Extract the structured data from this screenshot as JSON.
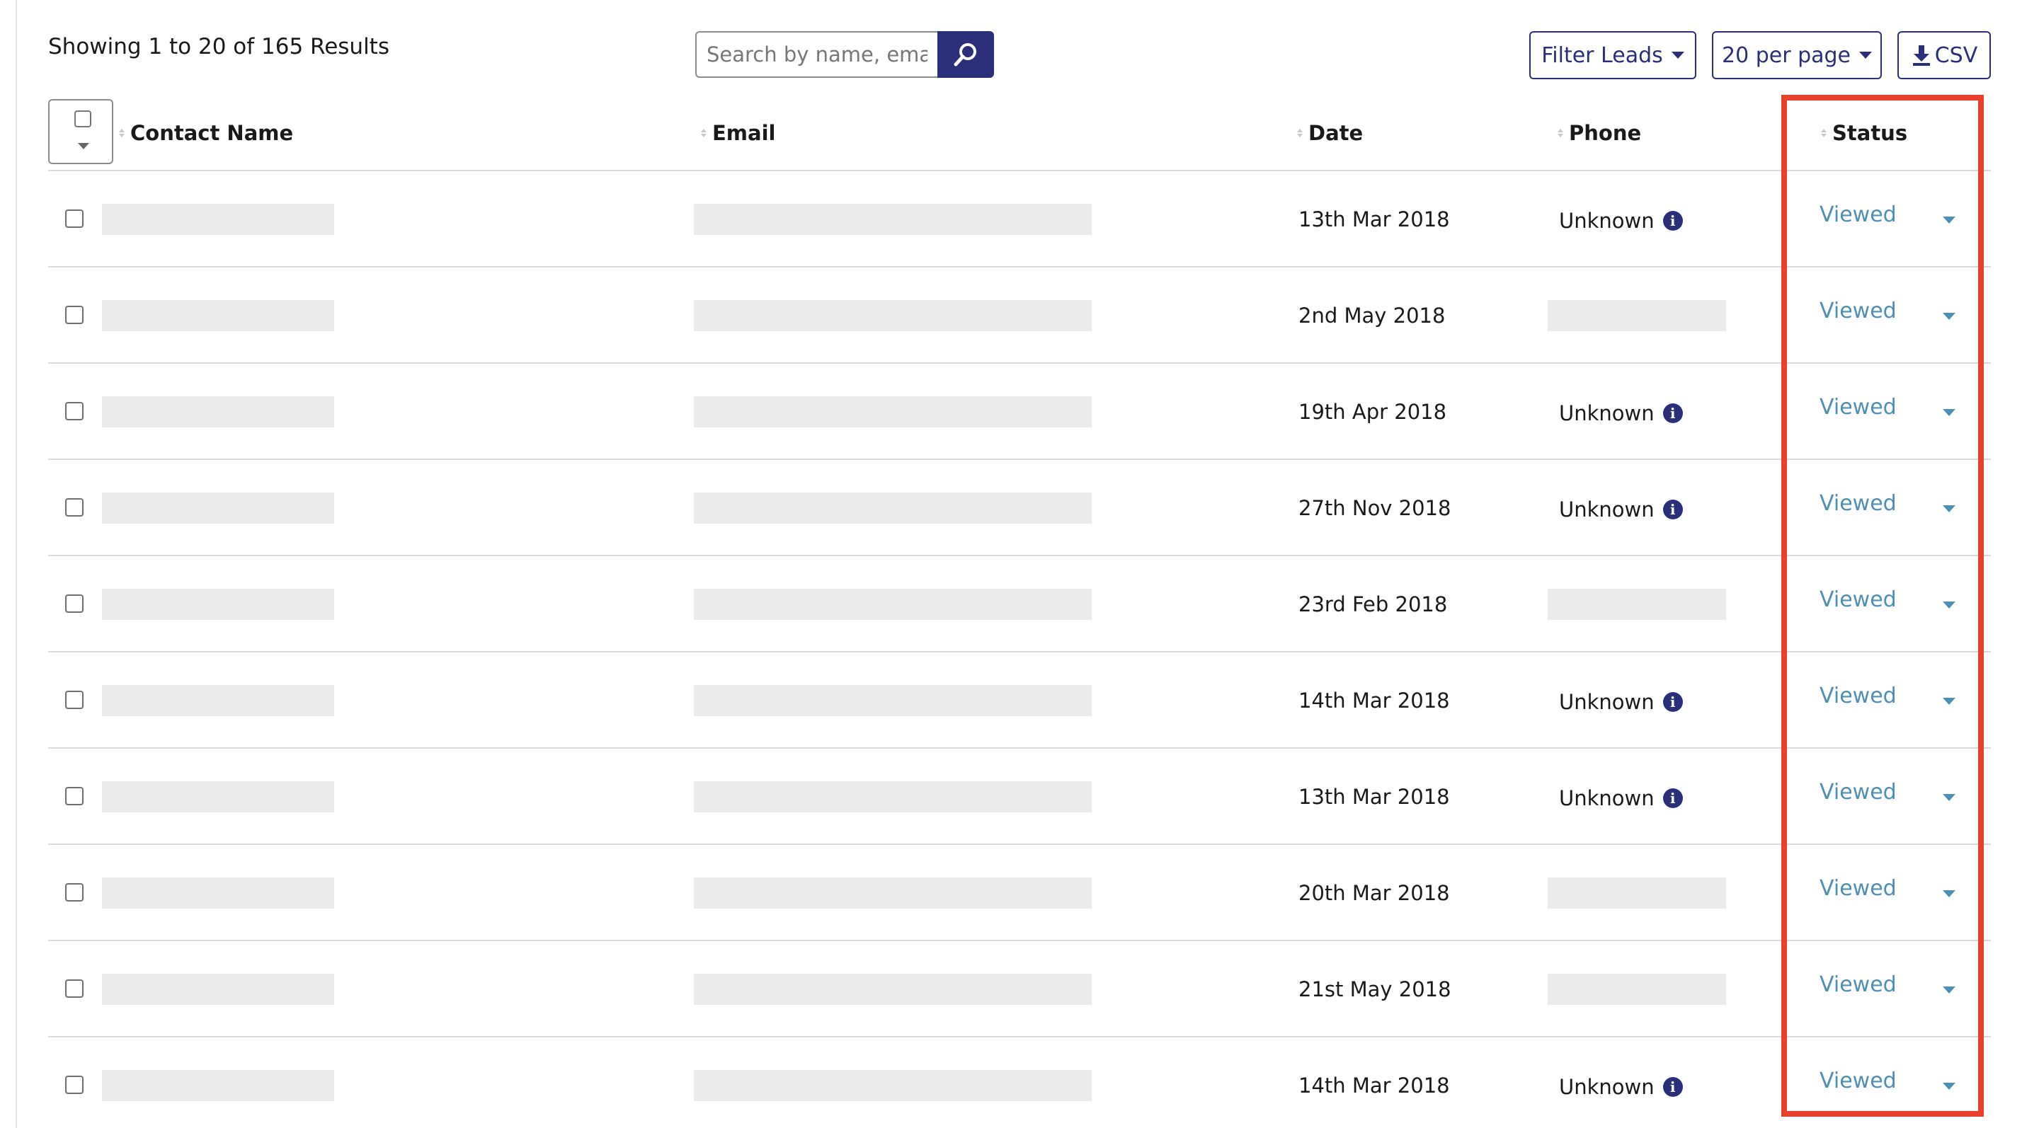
{
  "summary": {
    "results_text": "Showing 1 to 20 of 165 Results"
  },
  "search": {
    "placeholder": "Search by name, email or phone"
  },
  "toolbar": {
    "filter_label": "Filter Leads",
    "per_page_label": "20 per page",
    "csv_label": "CSV"
  },
  "table": {
    "headers": {
      "name": "Contact Name",
      "email": "Email",
      "date": "Date",
      "phone": "Phone",
      "status": "Status"
    },
    "rows": [
      {
        "date": "13th Mar 2018",
        "phone": "Unknown",
        "status": "Viewed"
      },
      {
        "date": "2nd May 2018",
        "phone": "",
        "status": "Viewed"
      },
      {
        "date": "19th Apr 2018",
        "phone": "Unknown",
        "status": "Viewed"
      },
      {
        "date": "27th Nov 2018",
        "phone": "Unknown",
        "status": "Viewed"
      },
      {
        "date": "23rd Feb 2018",
        "phone": "",
        "status": "Viewed"
      },
      {
        "date": "14th Mar 2018",
        "phone": "Unknown",
        "status": "Viewed"
      },
      {
        "date": "13th Mar 2018",
        "phone": "Unknown",
        "status": "Viewed"
      },
      {
        "date": "20th Mar 2018",
        "phone": "",
        "status": "Viewed"
      },
      {
        "date": "21st May 2018",
        "phone": "",
        "status": "Viewed"
      },
      {
        "date": "14th Mar 2018",
        "phone": "Unknown",
        "status": "Viewed"
      }
    ]
  },
  "colors": {
    "primary": "#2b2f7a",
    "status_link": "#4f8fb5",
    "highlight": "#e8402c",
    "redaction": "#ebebeb"
  },
  "icons": {
    "search": "search-icon",
    "download": "download-icon",
    "info": "info-icon",
    "caret": "caret-down-icon"
  }
}
